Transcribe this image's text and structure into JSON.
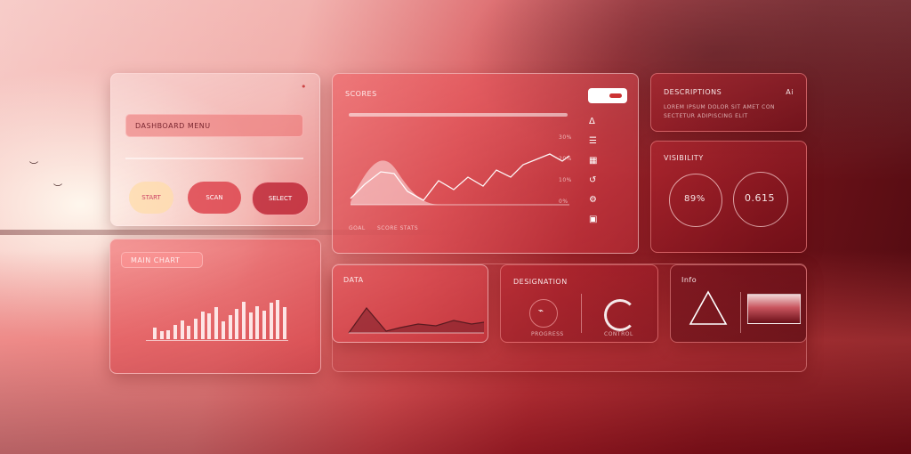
{
  "colors": {
    "accent": "#e2474f",
    "deep": "#6e1219",
    "light": "#f6c4c0"
  },
  "panel_form": {
    "header": "",
    "field_label": "DASHBOARD MENU",
    "buttons": [
      {
        "label": "START",
        "icon": "circle"
      },
      {
        "label": "SCAN",
        "icon": "circle"
      },
      {
        "label": "SELECT",
        "icon": "circle"
      }
    ],
    "menu_dot": "•"
  },
  "panel_bars": {
    "title": "MAIN CHART",
    "bars": [
      0.25,
      0.18,
      0.2,
      0.3,
      0.4,
      0.28,
      0.45,
      0.6,
      0.55,
      0.7,
      0.38,
      0.52,
      0.66,
      0.8,
      0.58,
      0.72,
      0.62,
      0.78,
      0.85,
      0.7
    ]
  },
  "panel_main": {
    "title": "SCORES",
    "toggle_label": "",
    "side_items": [
      "Δ",
      "☰",
      "▦",
      "↺",
      "⚙",
      "▣"
    ],
    "y_tick_labels": [
      "30%",
      "20%",
      "10%",
      "0%"
    ],
    "footer_left": "GOAL",
    "footer_right": "SCORE STATS"
  },
  "panel_info": {
    "title": "DESCRIPTIONS",
    "corner": "Ai",
    "lines": [
      "LOREM IPSUM DOLOR SIT AMET CON",
      "SECTETUR ADIPISCING ELIT"
    ]
  },
  "panel_gauges": {
    "title": "VISIBILITY",
    "values": [
      "89%",
      "0.615"
    ]
  },
  "panel_mini": {
    "title": "DATA"
  },
  "panel_progress": {
    "title": "DESIGNATION",
    "left_label": "PROGRESS",
    "right_label": "CONTROL"
  },
  "panel_photo": {
    "title": "Info"
  }
}
